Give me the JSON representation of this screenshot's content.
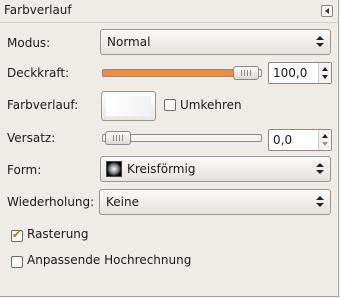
{
  "panel": {
    "title": "Farbverlauf"
  },
  "modus": {
    "label": "Modus:",
    "value": "Normal"
  },
  "deckkraft": {
    "label": "Deckkraft:",
    "value": "100,0",
    "level_fraction": 1.0,
    "fill_color": "#f08c3c"
  },
  "farbverlauf": {
    "label": "Farbverlauf:",
    "reverse_label": "Umkehren",
    "reverse_checked": false
  },
  "versatz": {
    "label": "Versatz:",
    "value": "0,0",
    "level_fraction": 0.0
  },
  "form": {
    "label": "Form:",
    "value": "Kreisförmig",
    "icon": "radial-gradient-icon"
  },
  "wiederholung": {
    "label": "Wiederholung:",
    "value": "Keine"
  },
  "rasterung": {
    "label": "Rasterung",
    "checked": true
  },
  "hochrechnung": {
    "label": "Anpassende Hochrechnung",
    "checked": false
  },
  "colors": {
    "background": "#efebe7",
    "accent": "#f08c3c",
    "check_mark": "#d4631a"
  }
}
